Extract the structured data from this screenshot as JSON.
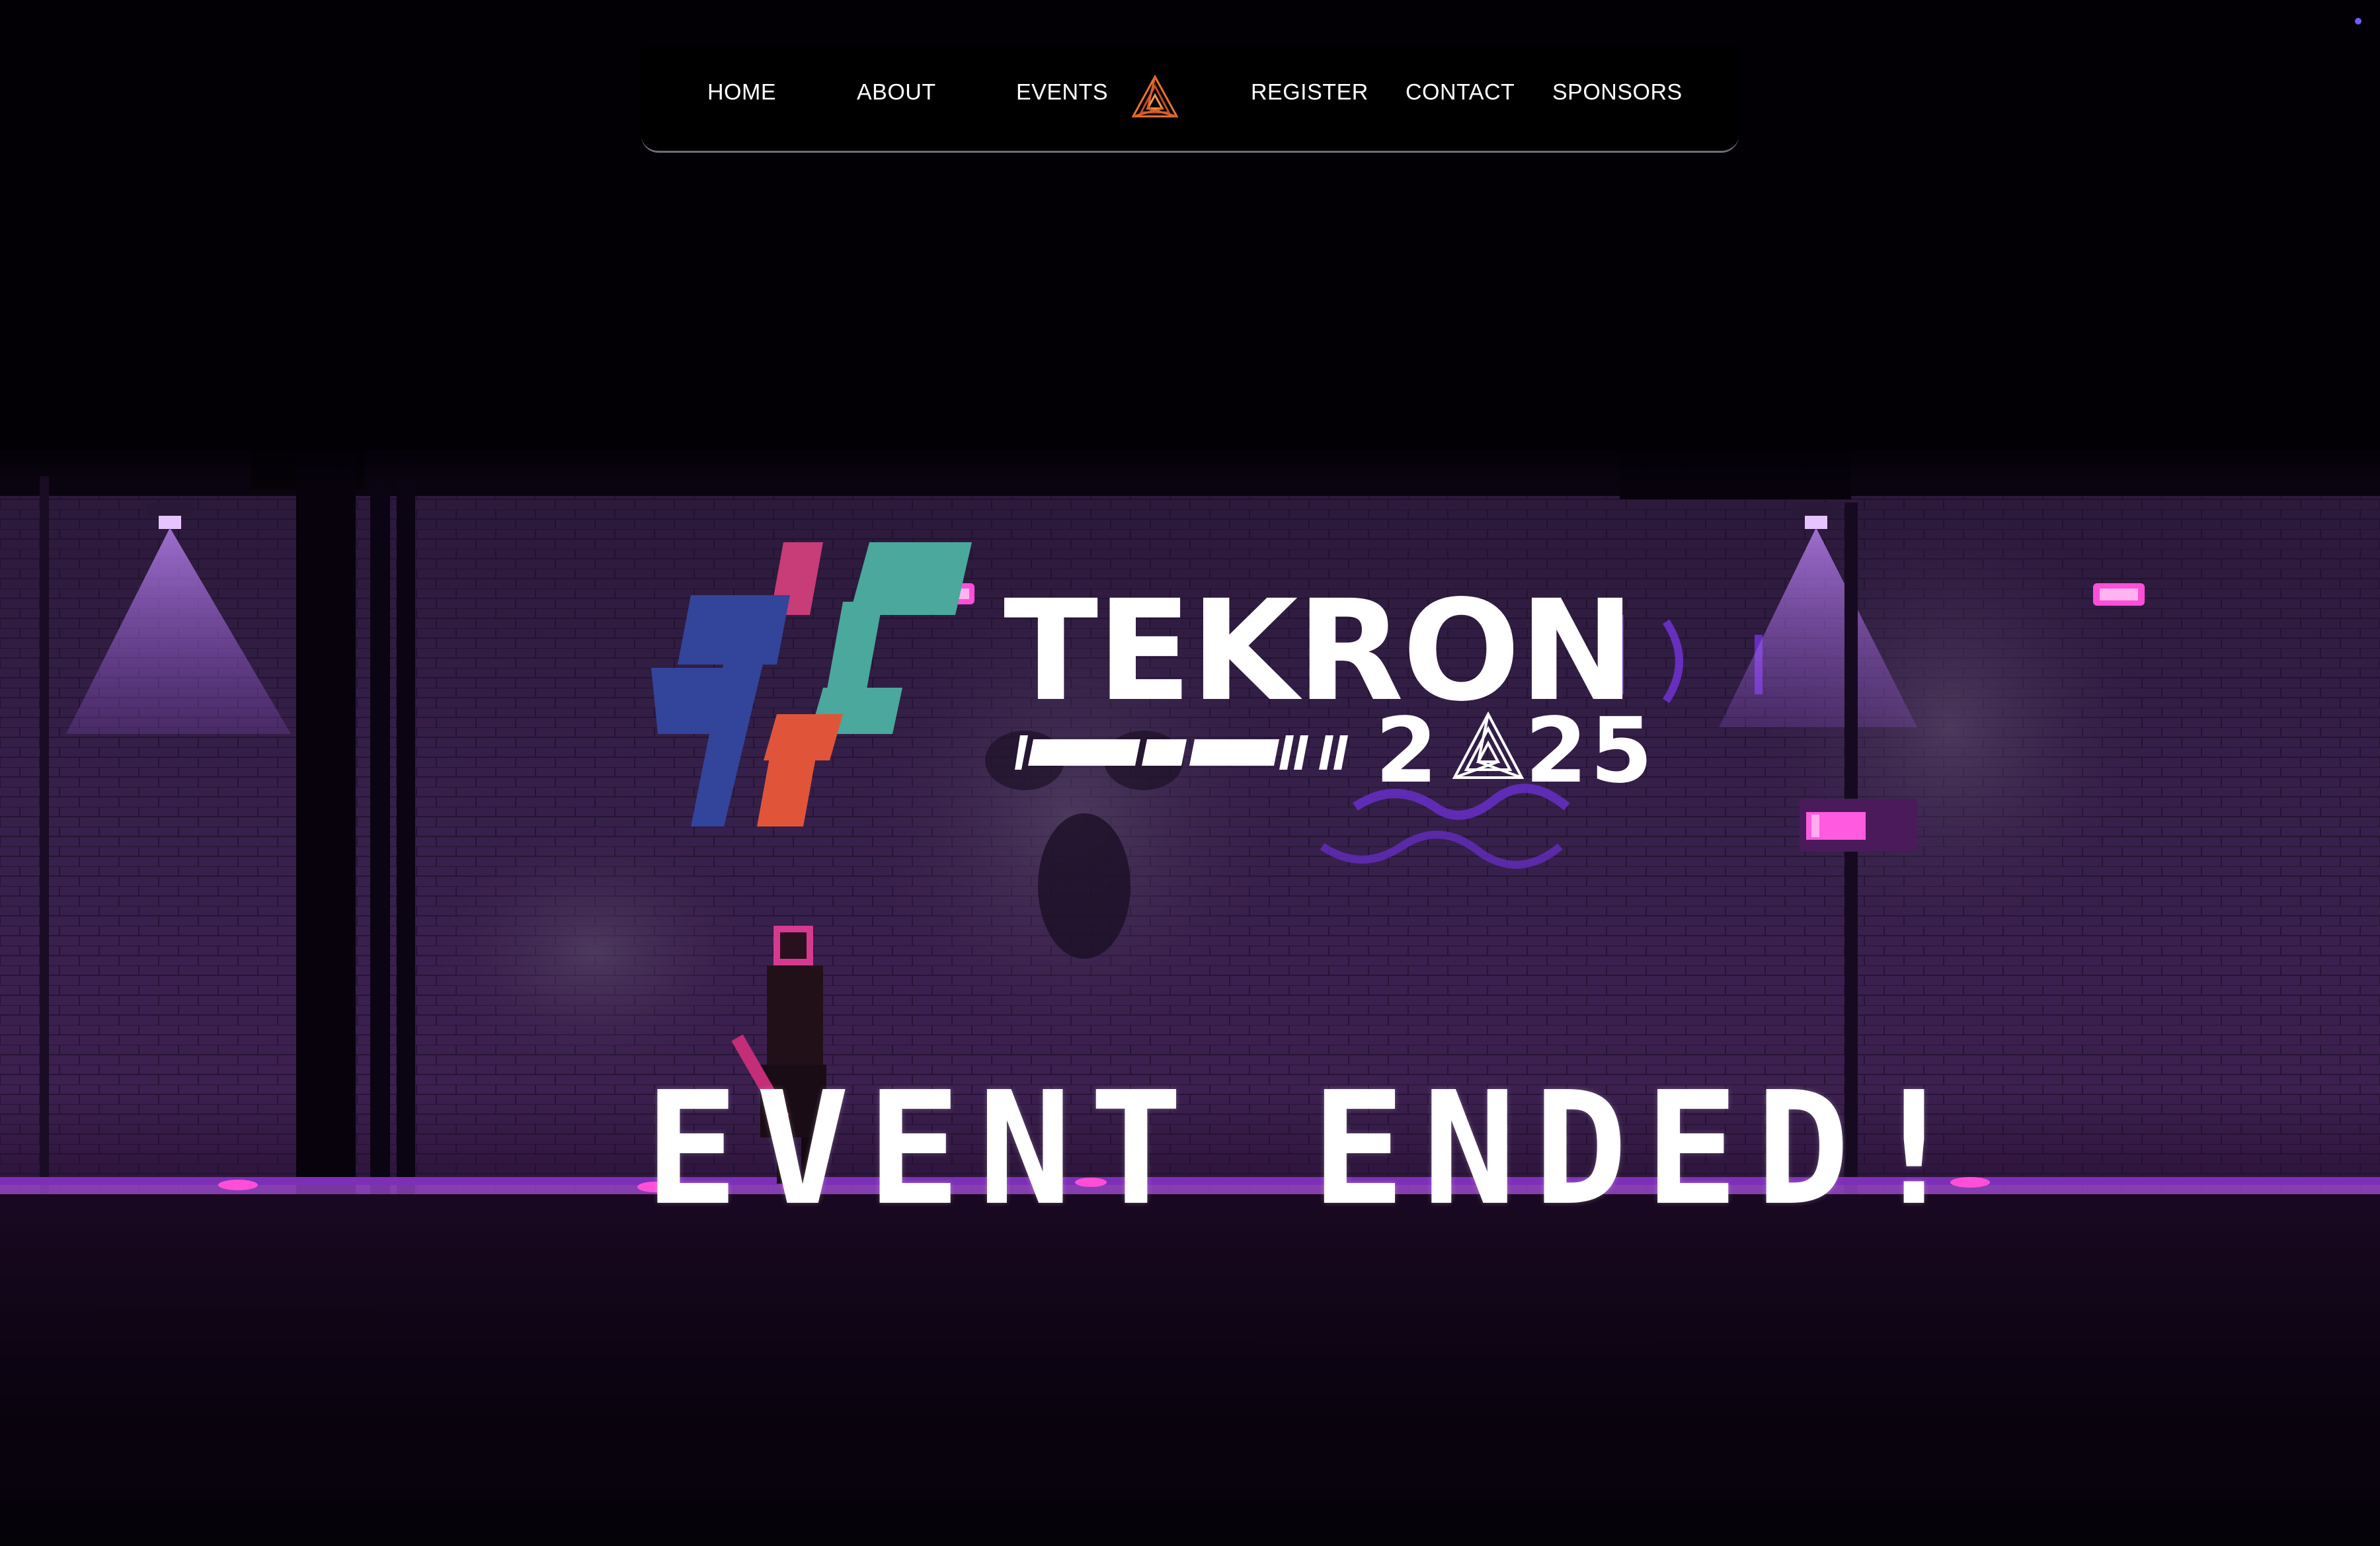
{
  "nav": {
    "items": [
      {
        "label": "HOME"
      },
      {
        "label": "ABOUT"
      },
      {
        "label": "EVENTS"
      },
      {
        "label": "REGISTER"
      },
      {
        "label": "CONTACT"
      },
      {
        "label": "SPONSORS"
      }
    ],
    "logo_icon": "triangle-emblem-icon"
  },
  "hero": {
    "brand_name": "TEKRON",
    "year_prefix": "2",
    "year_suffix": "25",
    "year_emblem_icon": "triangle-emblem-icon",
    "hash_icon": "hashtag-logo-icon",
    "headline": "EVENT ENDED!"
  },
  "colors": {
    "background": "#020005",
    "accent_purple": "#a64dff",
    "accent_magenta": "#ff3ccf",
    "hash_blue": "#33449b",
    "hash_pink": "#c83c78",
    "hash_teal": "#4aa89c",
    "hash_orange": "#e0553a"
  }
}
